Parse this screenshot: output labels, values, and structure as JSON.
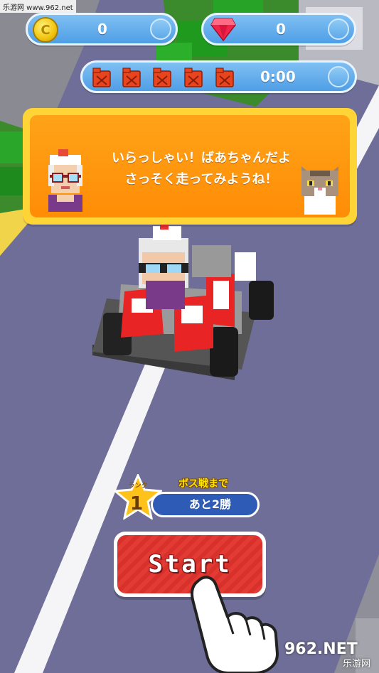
{
  "watermark_top": "乐游网 www.962.net",
  "hud": {
    "coins": "0",
    "gems": "0",
    "fuel_cans": [
      1,
      2,
      3,
      4,
      5
    ],
    "timer": "0:00"
  },
  "dialog": {
    "line1": "いらっしゃい！ばあちゃんだよ",
    "line2": "さっそく走ってみようね！"
  },
  "rank": {
    "label": "ランク",
    "value": "1"
  },
  "boss": {
    "label": "ボス戦まで",
    "remaining": "あと2勝"
  },
  "start_label": "Start",
  "watermark_bottom": {
    "logo": "962.NET",
    "sub": "乐游网"
  },
  "colors": {
    "road": "#6f6e98",
    "hud_blue": "#4f9ee6",
    "dialog_orange": "#ff8d06",
    "dialog_border": "#ffd437",
    "start_red": "#e33a34",
    "rank_star": "#ffc21a",
    "boss_pill": "#2d5bb5"
  }
}
